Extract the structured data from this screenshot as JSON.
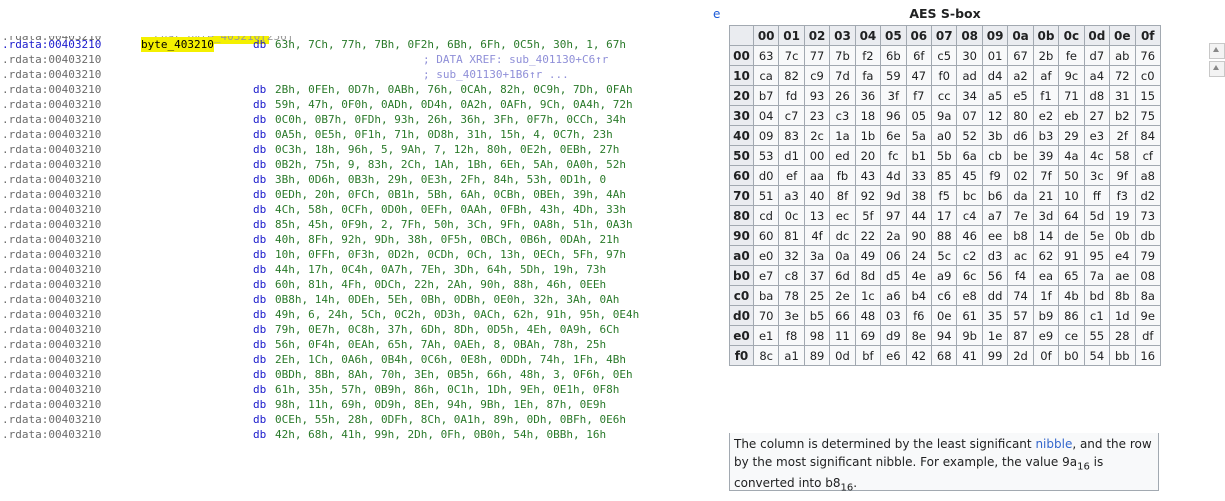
{
  "stray_text": "e",
  "fragment": {
    "address": ".rdata:00403210",
    "text": "; char byte_403210[256]"
  },
  "listing": [
    {
      "addr": ".rdata:00403210",
      "label": "byte_403210",
      "dir": "db",
      "ops": "63h, 7Ch, 77h, 7Bh, 0F2h, 6Bh, 6Fh, 0C5h, 30h, 1, 67h",
      "comment": "",
      "selected": true,
      "highlight": true
    },
    {
      "addr": ".rdata:00403210",
      "label": "",
      "dir": "",
      "ops": "",
      "comment": "; DATA XREF: sub_401130+C6↑r"
    },
    {
      "addr": ".rdata:00403210",
      "label": "",
      "dir": "",
      "ops": "",
      "comment": "; sub_401130+1B6↑r ..."
    },
    {
      "addr": ".rdata:00403210",
      "label": "",
      "dir": "db",
      "ops": "2Bh, 0FEh, 0D7h, 0ABh, 76h, 0CAh, 82h, 0C9h, 7Dh, 0FAh",
      "comment": ""
    },
    {
      "addr": ".rdata:00403210",
      "label": "",
      "dir": "db",
      "ops": "59h, 47h, 0F0h, 0ADh, 0D4h, 0A2h, 0AFh, 9Ch, 0A4h, 72h",
      "comment": ""
    },
    {
      "addr": ".rdata:00403210",
      "label": "",
      "dir": "db",
      "ops": "0C0h, 0B7h, 0FDh, 93h, 26h, 36h, 3Fh, 0F7h, 0CCh, 34h",
      "comment": ""
    },
    {
      "addr": ".rdata:00403210",
      "label": "",
      "dir": "db",
      "ops": "0A5h, 0E5h, 0F1h, 71h, 0D8h, 31h, 15h, 4, 0C7h, 23h",
      "comment": ""
    },
    {
      "addr": ".rdata:00403210",
      "label": "",
      "dir": "db",
      "ops": "0C3h, 18h, 96h, 5, 9Ah, 7, 12h, 80h, 0E2h, 0EBh, 27h",
      "comment": ""
    },
    {
      "addr": ".rdata:00403210",
      "label": "",
      "dir": "db",
      "ops": "0B2h, 75h, 9, 83h, 2Ch, 1Ah, 1Bh, 6Eh, 5Ah, 0A0h, 52h",
      "comment": ""
    },
    {
      "addr": ".rdata:00403210",
      "label": "",
      "dir": "db",
      "ops": "3Bh, 0D6h, 0B3h, 29h, 0E3h, 2Fh, 84h, 53h, 0D1h, 0",
      "comment": ""
    },
    {
      "addr": ".rdata:00403210",
      "label": "",
      "dir": "db",
      "ops": "0EDh, 20h, 0FCh, 0B1h, 5Bh, 6Ah, 0CBh, 0BEh, 39h, 4Ah",
      "comment": ""
    },
    {
      "addr": ".rdata:00403210",
      "label": "",
      "dir": "db",
      "ops": "4Ch, 58h, 0CFh, 0D0h, 0EFh, 0AAh, 0FBh, 43h, 4Dh, 33h",
      "comment": ""
    },
    {
      "addr": ".rdata:00403210",
      "label": "",
      "dir": "db",
      "ops": "85h, 45h, 0F9h, 2, 7Fh, 50h, 3Ch, 9Fh, 0A8h, 51h, 0A3h",
      "comment": ""
    },
    {
      "addr": ".rdata:00403210",
      "label": "",
      "dir": "db",
      "ops": "40h, 8Fh, 92h, 9Dh, 38h, 0F5h, 0BCh, 0B6h, 0DAh, 21h",
      "comment": ""
    },
    {
      "addr": ".rdata:00403210",
      "label": "",
      "dir": "db",
      "ops": "10h, 0FFh, 0F3h, 0D2h, 0CDh, 0Ch, 13h, 0ECh, 5Fh, 97h",
      "comment": ""
    },
    {
      "addr": ".rdata:00403210",
      "label": "",
      "dir": "db",
      "ops": "44h, 17h, 0C4h, 0A7h, 7Eh, 3Dh, 64h, 5Dh, 19h, 73h",
      "comment": ""
    },
    {
      "addr": ".rdata:00403210",
      "label": "",
      "dir": "db",
      "ops": "60h, 81h, 4Fh, 0DCh, 22h, 2Ah, 90h, 88h, 46h, 0EEh",
      "comment": ""
    },
    {
      "addr": ".rdata:00403210",
      "label": "",
      "dir": "db",
      "ops": "0B8h, 14h, 0DEh, 5Eh, 0Bh, 0DBh, 0E0h, 32h, 3Ah, 0Ah",
      "comment": ""
    },
    {
      "addr": ".rdata:00403210",
      "label": "",
      "dir": "db",
      "ops": "49h, 6, 24h, 5Ch, 0C2h, 0D3h, 0ACh, 62h, 91h, 95h, 0E4h",
      "comment": ""
    },
    {
      "addr": ".rdata:00403210",
      "label": "",
      "dir": "db",
      "ops": "79h, 0E7h, 0C8h, 37h, 6Dh, 8Dh, 0D5h, 4Eh, 0A9h, 6Ch",
      "comment": ""
    },
    {
      "addr": ".rdata:00403210",
      "label": "",
      "dir": "db",
      "ops": "56h, 0F4h, 0EAh, 65h, 7Ah, 0AEh, 8, 0BAh, 78h, 25h",
      "comment": ""
    },
    {
      "addr": ".rdata:00403210",
      "label": "",
      "dir": "db",
      "ops": "2Eh, 1Ch, 0A6h, 0B4h, 0C6h, 0E8h, 0DDh, 74h, 1Fh, 4Bh",
      "comment": ""
    },
    {
      "addr": ".rdata:00403210",
      "label": "",
      "dir": "db",
      "ops": "0BDh, 8Bh, 8Ah, 70h, 3Eh, 0B5h, 66h, 48h, 3, 0F6h, 0Eh",
      "comment": ""
    },
    {
      "addr": ".rdata:00403210",
      "label": "",
      "dir": "db",
      "ops": "61h, 35h, 57h, 0B9h, 86h, 0C1h, 1Dh, 9Eh, 0E1h, 0F8h",
      "comment": ""
    },
    {
      "addr": ".rdata:00403210",
      "label": "",
      "dir": "db",
      "ops": "98h, 11h, 69h, 0D9h, 8Eh, 94h, 9Bh, 1Eh, 87h, 0E9h",
      "comment": ""
    },
    {
      "addr": ".rdata:00403210",
      "label": "",
      "dir": "db",
      "ops": "0CEh, 55h, 28h, 0DFh, 8Ch, 0A1h, 89h, 0Dh, 0BFh, 0E6h",
      "comment": ""
    },
    {
      "addr": ".rdata:00403210",
      "label": "",
      "dir": "db",
      "ops": "42h, 68h, 41h, 99h, 2Dh, 0Fh, 0B0h, 54h, 0BBh, 16h",
      "comment": ""
    }
  ],
  "sbox": {
    "title": "AES S-box",
    "columns": [
      "00",
      "01",
      "02",
      "03",
      "04",
      "05",
      "06",
      "07",
      "08",
      "09",
      "0a",
      "0b",
      "0c",
      "0d",
      "0e",
      "0f"
    ],
    "rows": [
      {
        "h": "00",
        "v": [
          "63",
          "7c",
          "77",
          "7b",
          "f2",
          "6b",
          "6f",
          "c5",
          "30",
          "01",
          "67",
          "2b",
          "fe",
          "d7",
          "ab",
          "76"
        ]
      },
      {
        "h": "10",
        "v": [
          "ca",
          "82",
          "c9",
          "7d",
          "fa",
          "59",
          "47",
          "f0",
          "ad",
          "d4",
          "a2",
          "af",
          "9c",
          "a4",
          "72",
          "c0"
        ]
      },
      {
        "h": "20",
        "v": [
          "b7",
          "fd",
          "93",
          "26",
          "36",
          "3f",
          "f7",
          "cc",
          "34",
          "a5",
          "e5",
          "f1",
          "71",
          "d8",
          "31",
          "15"
        ]
      },
      {
        "h": "30",
        "v": [
          "04",
          "c7",
          "23",
          "c3",
          "18",
          "96",
          "05",
          "9a",
          "07",
          "12",
          "80",
          "e2",
          "eb",
          "27",
          "b2",
          "75"
        ]
      },
      {
        "h": "40",
        "v": [
          "09",
          "83",
          "2c",
          "1a",
          "1b",
          "6e",
          "5a",
          "a0",
          "52",
          "3b",
          "d6",
          "b3",
          "29",
          "e3",
          "2f",
          "84"
        ]
      },
      {
        "h": "50",
        "v": [
          "53",
          "d1",
          "00",
          "ed",
          "20",
          "fc",
          "b1",
          "5b",
          "6a",
          "cb",
          "be",
          "39",
          "4a",
          "4c",
          "58",
          "cf"
        ]
      },
      {
        "h": "60",
        "v": [
          "d0",
          "ef",
          "aa",
          "fb",
          "43",
          "4d",
          "33",
          "85",
          "45",
          "f9",
          "02",
          "7f",
          "50",
          "3c",
          "9f",
          "a8"
        ]
      },
      {
        "h": "70",
        "v": [
          "51",
          "a3",
          "40",
          "8f",
          "92",
          "9d",
          "38",
          "f5",
          "bc",
          "b6",
          "da",
          "21",
          "10",
          "ff",
          "f3",
          "d2"
        ]
      },
      {
        "h": "80",
        "v": [
          "cd",
          "0c",
          "13",
          "ec",
          "5f",
          "97",
          "44",
          "17",
          "c4",
          "a7",
          "7e",
          "3d",
          "64",
          "5d",
          "19",
          "73"
        ]
      },
      {
        "h": "90",
        "v": [
          "60",
          "81",
          "4f",
          "dc",
          "22",
          "2a",
          "90",
          "88",
          "46",
          "ee",
          "b8",
          "14",
          "de",
          "5e",
          "0b",
          "db"
        ]
      },
      {
        "h": "a0",
        "v": [
          "e0",
          "32",
          "3a",
          "0a",
          "49",
          "06",
          "24",
          "5c",
          "c2",
          "d3",
          "ac",
          "62",
          "91",
          "95",
          "e4",
          "79"
        ]
      },
      {
        "h": "b0",
        "v": [
          "e7",
          "c8",
          "37",
          "6d",
          "8d",
          "d5",
          "4e",
          "a9",
          "6c",
          "56",
          "f4",
          "ea",
          "65",
          "7a",
          "ae",
          "08"
        ]
      },
      {
        "h": "c0",
        "v": [
          "ba",
          "78",
          "25",
          "2e",
          "1c",
          "a6",
          "b4",
          "c6",
          "e8",
          "dd",
          "74",
          "1f",
          "4b",
          "bd",
          "8b",
          "8a"
        ]
      },
      {
        "h": "d0",
        "v": [
          "70",
          "3e",
          "b5",
          "66",
          "48",
          "03",
          "f6",
          "0e",
          "61",
          "35",
          "57",
          "b9",
          "86",
          "c1",
          "1d",
          "9e"
        ]
      },
      {
        "h": "e0",
        "v": [
          "e1",
          "f8",
          "98",
          "11",
          "69",
          "d9",
          "8e",
          "94",
          "9b",
          "1e",
          "87",
          "e9",
          "ce",
          "55",
          "28",
          "df"
        ]
      },
      {
        "h": "f0",
        "v": [
          "8c",
          "a1",
          "89",
          "0d",
          "bf",
          "e6",
          "42",
          "68",
          "41",
          "99",
          "2d",
          "0f",
          "b0",
          "54",
          "bb",
          "16"
        ]
      }
    ],
    "caption": {
      "part1": "The column is determined by the least significant ",
      "link": "nibble",
      "part2": ", and the row by the most significant nibble. For example, the value 9a",
      "sub1": "16",
      "part3": " is converted into b8",
      "sub2": "16",
      "part4": "."
    }
  }
}
